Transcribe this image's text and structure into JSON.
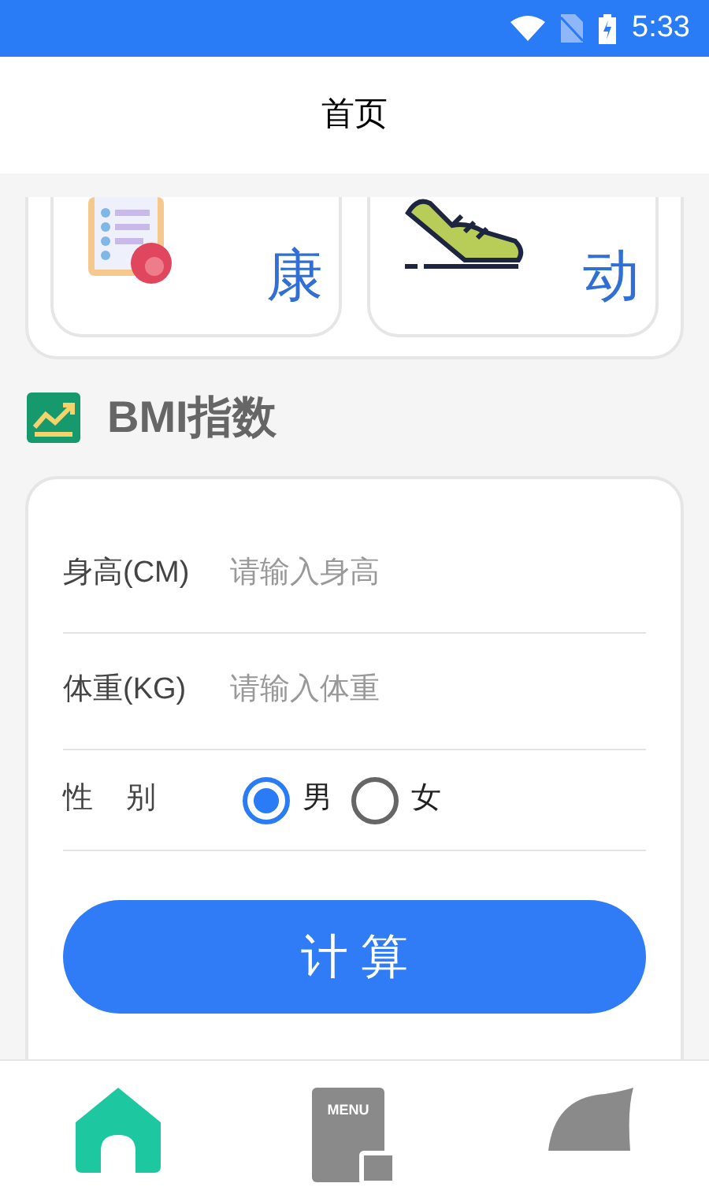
{
  "status_bar": {
    "time": "5:33"
  },
  "header": {
    "title": "首页"
  },
  "feature_cards": [
    {
      "kind": "health",
      "label": "康"
    },
    {
      "kind": "sport",
      "label": "动"
    }
  ],
  "section": {
    "title": "BMI指数"
  },
  "form": {
    "fields": [
      {
        "label": "身高(CM)",
        "placeholder": "请输入身高"
      },
      {
        "label": "体重(KG)",
        "placeholder": "请输入体重"
      }
    ],
    "gender": {
      "label": "性    别",
      "options": [
        {
          "label": "男",
          "selected": true
        },
        {
          "label": "女",
          "selected": false
        }
      ]
    },
    "button": "计 算"
  },
  "bottom_nav": [
    {
      "kind": "home",
      "selected": true
    },
    {
      "kind": "menu",
      "badge": "MENU",
      "selected": false
    },
    {
      "kind": "dome",
      "selected": false
    }
  ]
}
